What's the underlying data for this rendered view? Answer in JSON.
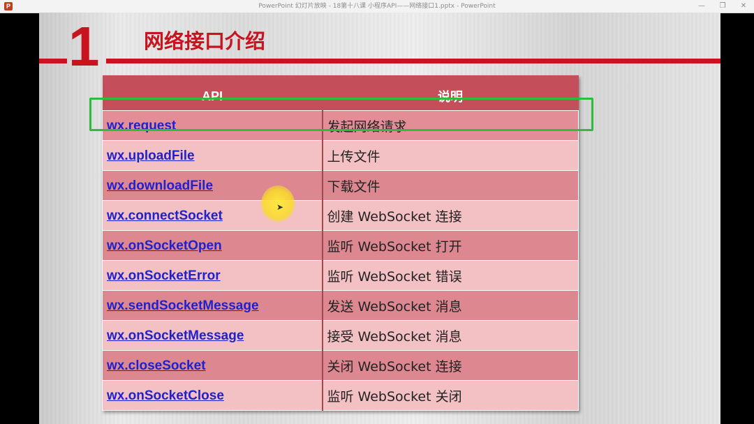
{
  "window": {
    "title": "PowerPoint 幻灯片放映 - 18第十八课 小程序API——网络接口1.pptx - PowerPoint",
    "app_icon_letter": "P",
    "controls": [
      "—",
      "❐",
      "✕"
    ]
  },
  "slide": {
    "number": "1",
    "title": "网络接口介绍",
    "accent_color": "#c8141e",
    "table": {
      "headers": [
        "API",
        "说明"
      ],
      "rows": [
        {
          "api": "wx.request",
          "desc": "发起网络请求"
        },
        {
          "api": "wx.uploadFile",
          "desc": "上传文件"
        },
        {
          "api": "wx.downloadFile",
          "desc": "下载文件"
        },
        {
          "api": "wx.connectSocket",
          "desc": "创建 WebSocket 连接"
        },
        {
          "api": "wx.onSocketOpen",
          "desc": "监听 WebSocket 打开"
        },
        {
          "api": "wx.onSocketError",
          "desc": "监听 WebSocket 错误"
        },
        {
          "api": "wx.sendSocketMessage",
          "desc": "发送 WebSocket 消息"
        },
        {
          "api": "wx.onSocketMessage",
          "desc": "接受 WebSocket 消息"
        },
        {
          "api": "wx.closeSocket",
          "desc": "关闭 WebSocket 连接"
        },
        {
          "api": "wx.onSocketClose",
          "desc": "监听 WebSocket 关闭"
        }
      ]
    },
    "highlight_color": "#2fbb3e",
    "cursor_icon": "pointer-arrow-icon"
  }
}
